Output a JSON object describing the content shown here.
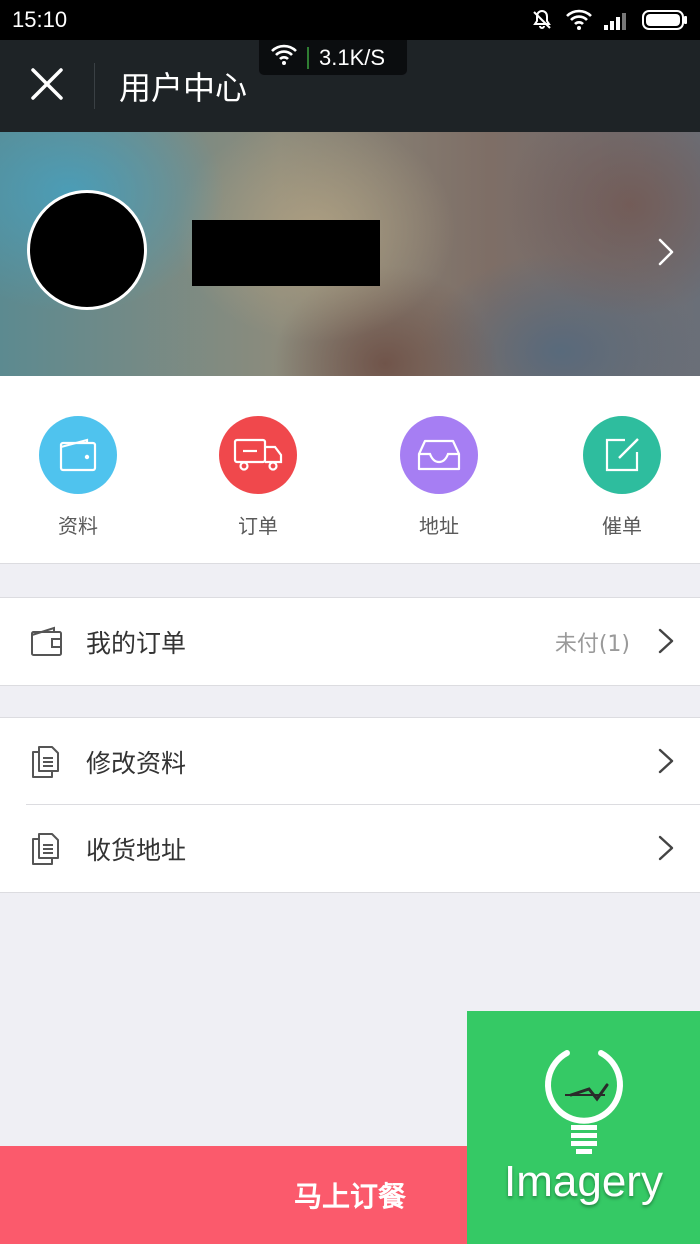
{
  "status_bar": {
    "time": "15:10",
    "icons": [
      "mute-icon",
      "wifi-icon",
      "signal-icon",
      "battery-icon"
    ]
  },
  "net_speed": {
    "icon": "wifi-icon",
    "value": "3.1K/S"
  },
  "header": {
    "close_icon": "close-icon",
    "title": "用户中心"
  },
  "profile": {
    "avatar": "avatar",
    "username_redacted": true,
    "chevron_icon": "chevron-right-icon"
  },
  "quick_actions": [
    {
      "label": "资料",
      "icon": "wallet-icon",
      "color": "#4fc3ee"
    },
    {
      "label": "订单",
      "icon": "truck-icon",
      "color": "#f0484c"
    },
    {
      "label": "地址",
      "icon": "inbox-icon",
      "color": "#a67ef3"
    },
    {
      "label": "催单",
      "icon": "edit-icon",
      "color": "#2ebd9e"
    }
  ],
  "orders_section": {
    "label": "我的订单",
    "value": "未付(1)",
    "icon": "wallet-icon"
  },
  "settings_section": [
    {
      "label": "修改资料",
      "icon": "document-icon"
    },
    {
      "label": "收货地址",
      "icon": "document-icon"
    }
  ],
  "bottom_button": {
    "label": "马上订餐",
    "color": "#fb5a6c"
  },
  "watermark": {
    "text": "Imagery",
    "color": "#35c965"
  }
}
